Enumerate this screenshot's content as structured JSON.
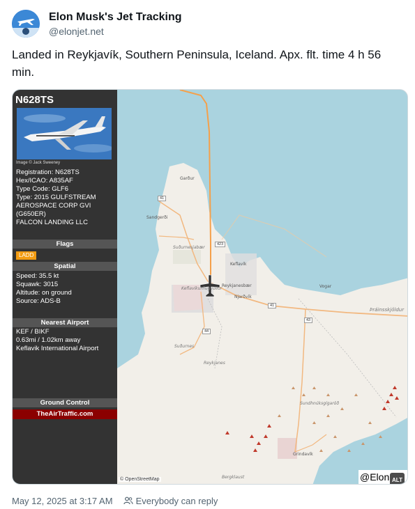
{
  "post": {
    "display_name": "Elon Musk's Jet Tracking",
    "handle": "@elonjet.net",
    "text": "Landed in Reykjavík, Southern Peninsula, Iceland. Apx. flt. time 4 h 56 min.",
    "date": "May 12, 2025 at 3:17 AM",
    "audience": "Everybody can reply",
    "audience_icon": "people-icon",
    "avatar_icon": "jet-avatar-icon"
  },
  "panel": {
    "registration_title": "N628TS",
    "image_credit": "Image © Jack Sweeney",
    "details": [
      "Registration: N628TS",
      "Hex/ICAO: A835AF",
      "Type Code: GLF6",
      "Type: 2015 GULFSTREAM",
      "AEROSPACE CORP GVI",
      "(G650ER)",
      "FALCON LANDING LLC"
    ],
    "flags_heading": "Flags",
    "flag_badge": "LADD",
    "spatial_heading": "Spatial",
    "spatial": [
      "Speed: 35.5 kt",
      "Squawk: 3015",
      "Altitude: on ground",
      "Source: ADS-B"
    ],
    "nearest_heading": "Nearest Airport",
    "nearest": [
      "KEF / BIKF",
      "0.63mi / 1.02km away",
      "Keflavik International Airport"
    ],
    "ground_heading": "Ground Control",
    "ground_link": "TheAirTraffic.com"
  },
  "map": {
    "labels": {
      "gardur": "Garður",
      "sandgerdi": "Sandgerði",
      "sudurnesjabaer": "Suðurnesjabær",
      "keflavik": "Keflavík",
      "reykjanesbaer": "Reykjanesbær",
      "njardvik": "Njarðvík",
      "keflavikurflugvollur": "Keflavíkurflugvöllur",
      "vogar": "Vogar",
      "thrainsskjoldur": "Þráinsskjöldur",
      "sudurnes": "Suðurnes",
      "reykjanes": "Reykjanes",
      "sundhnukur": "Sundhnúksgígaröð",
      "grindavik": "Grindavík",
      "bergklaust": "Bergklaust"
    },
    "routes": [
      "41",
      "423",
      "41",
      "43",
      "44"
    ],
    "attribution": "© OpenStreetMap",
    "watermark": "@Elon",
    "alt_badge": "ALT",
    "colors": {
      "sea": "#aad3df",
      "land": "#f2efe9",
      "track": "#f5a04a",
      "road": "#f2b880"
    }
  }
}
